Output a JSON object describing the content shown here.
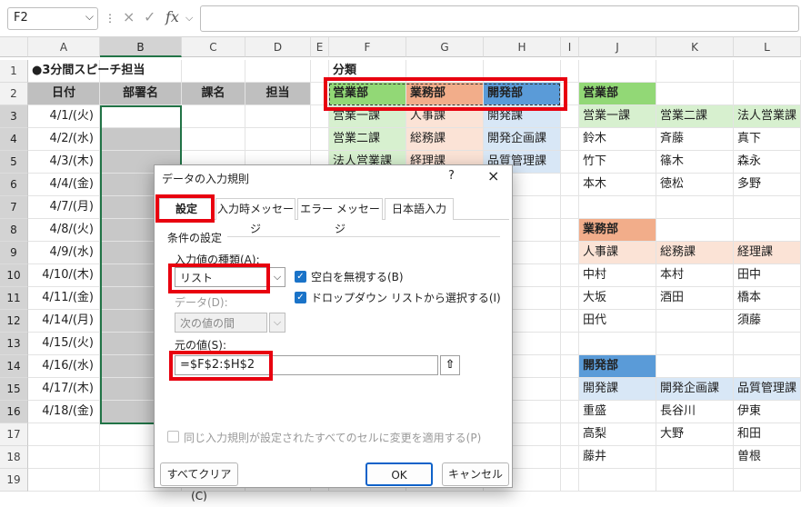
{
  "formula_bar": {
    "name_box": "F2",
    "cancel_icon": "×",
    "enter_icon": "✓",
    "fx_label": "fx",
    "value": ""
  },
  "columns": [
    "A",
    "B",
    "C",
    "D",
    "E",
    "F",
    "G",
    "H",
    "I",
    "J",
    "K",
    "L"
  ],
  "rows": [
    "1",
    "2",
    "3",
    "4",
    "5",
    "6",
    "7",
    "8",
    "9",
    "10",
    "11",
    "12",
    "13",
    "14",
    "15",
    "16",
    "17",
    "18",
    "19"
  ],
  "sheet": {
    "title": "●3分間スピーチ担当",
    "headers": {
      "date": "日付",
      "dept": "部署名",
      "section": "課名",
      "person": "担当"
    },
    "dates": [
      "4/1/(火)",
      "4/2/(水)",
      "4/3/(木)",
      "4/4/(金)",
      "4/7/(月)",
      "4/8/(火)",
      "4/9/(水)",
      "4/10/(木)",
      "4/11/(金)",
      "4/14/(月)",
      "4/15/(火)",
      "4/16/(水)",
      "4/17/(木)",
      "4/18/(金)"
    ],
    "category_title": "分類",
    "categories": {
      "dept1": "営業部",
      "dept2": "業務部",
      "dept3": "開発部",
      "col1": [
        "営業一課",
        "営業二課",
        "法人営業課"
      ],
      "col2": [
        "人事課",
        "総務課",
        "経理課"
      ],
      "col3": [
        "開発課",
        "開発企画課",
        "品質管理課"
      ]
    },
    "sales": {
      "title": "営業部",
      "sections": [
        "営業一課",
        "営業二課",
        "法人営業課"
      ],
      "members": [
        [
          "鈴木",
          "斉藤",
          "真下"
        ],
        [
          "竹下",
          "篠木",
          "森永"
        ],
        [
          "本木",
          "徳松",
          "多野"
        ]
      ]
    },
    "admin": {
      "title": "業務部",
      "sections": [
        "人事課",
        "総務課",
        "経理課"
      ],
      "members": [
        [
          "中村",
          "本村",
          "田中"
        ],
        [
          "大坂",
          "酒田",
          "橋本"
        ],
        [
          "田代",
          "",
          "須藤"
        ]
      ]
    },
    "dev": {
      "title": "開発部",
      "sections": [
        "開発課",
        "開発企画課",
        "品質管理課"
      ],
      "members": [
        [
          "重盛",
          "長谷川",
          "伊東"
        ],
        [
          "高梨",
          "大野",
          "和田"
        ],
        [
          "藤井",
          "",
          "曽根"
        ]
      ]
    }
  },
  "dialog": {
    "title": "データの入力規則",
    "help": "?",
    "close": "×",
    "tabs": [
      "設定",
      "入力時メッセージ",
      "エラー メッセージ",
      "日本語入力"
    ],
    "section_label": "条件の設定",
    "allow_label": "入力値の種類(A):",
    "allow_value": "リスト",
    "ignore_blank": "空白を無視する(B)",
    "in_cell_dropdown": "ドロップダウン リストから選択する(I)",
    "data_label": "データ(D):",
    "data_value": "次の値の間",
    "source_label": "元の値(S):",
    "source_value": "=$F$2:$H$2",
    "apply_all": "同じ入力規則が設定されたすべてのセルに変更を適用する(P)",
    "clear_all": "すべてクリア(C)",
    "ok": "OK",
    "cancel": "キャンセル"
  },
  "colors": {
    "sales": "#92d876",
    "admin": "#f2ad8a",
    "dev": "#5a9bd8",
    "highlight": "#e8000f",
    "selection": "#217346"
  }
}
